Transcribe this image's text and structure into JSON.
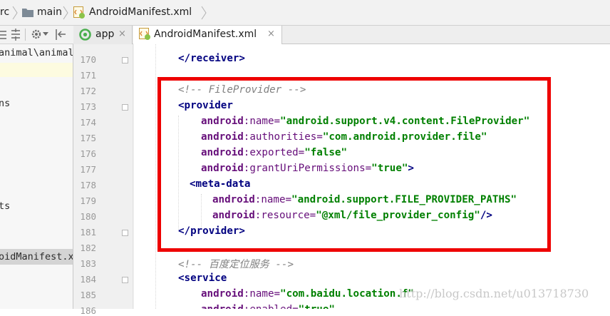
{
  "breadcrumb": {
    "items": [
      {
        "label": "rc",
        "icon": "none"
      },
      {
        "label": "main",
        "icon": "folder-icon"
      },
      {
        "label": "AndroidManifest.xml",
        "icon": "manifest-file-icon"
      }
    ]
  },
  "project_tree": {
    "items": [
      {
        "label": "animal\\animals"
      },
      {
        "label": "ns"
      },
      {
        "label": "ts"
      },
      {
        "label": "oidManifest.x"
      }
    ],
    "selected_item": "oidManifest.x"
  },
  "tabs": [
    {
      "label": "app",
      "icon": "app-module-icon",
      "close": "×",
      "active": false
    },
    {
      "label": "AndroidManifest.xml",
      "icon": "manifest-file-icon",
      "close": "×",
      "active": true
    }
  ],
  "editor": {
    "lines": [
      {
        "num": "170",
        "indent": 2,
        "parts": [
          [
            "tag",
            "</receiver>"
          ]
        ]
      },
      {
        "num": "171",
        "indent": 0,
        "parts": []
      },
      {
        "num": "172",
        "indent": 2,
        "parts": [
          [
            "cmt",
            "<!-- FileProvider -->"
          ]
        ]
      },
      {
        "num": "173",
        "indent": 2,
        "parts": [
          [
            "tag",
            "<provider"
          ]
        ]
      },
      {
        "num": "174",
        "indent": 6,
        "parts": [
          [
            "attrns",
            "android"
          ],
          [
            "attr",
            ":name="
          ],
          [
            "val",
            "\"android.support.v4.content.FileProvider\""
          ]
        ]
      },
      {
        "num": "175",
        "indent": 6,
        "parts": [
          [
            "attrns",
            "android"
          ],
          [
            "attr",
            ":authorities="
          ],
          [
            "val",
            "\"com.android.provider.file\""
          ]
        ]
      },
      {
        "num": "176",
        "indent": 6,
        "parts": [
          [
            "attrns",
            "android"
          ],
          [
            "attr",
            ":exported="
          ],
          [
            "val",
            "\"false\""
          ]
        ]
      },
      {
        "num": "177",
        "indent": 6,
        "parts": [
          [
            "attrns",
            "android"
          ],
          [
            "attr",
            ":grantUriPermissions="
          ],
          [
            "val",
            "\"true\""
          ],
          [
            "tag",
            ">"
          ]
        ]
      },
      {
        "num": "178",
        "indent": 4,
        "parts": [
          [
            "tag",
            "<meta-data"
          ]
        ]
      },
      {
        "num": "179",
        "indent": 8,
        "parts": [
          [
            "attrns",
            "android"
          ],
          [
            "attr",
            ":name="
          ],
          [
            "val",
            "\"android.support.FILE_PROVIDER_PATHS\""
          ]
        ]
      },
      {
        "num": "180",
        "indent": 8,
        "parts": [
          [
            "attrns",
            "android"
          ],
          [
            "attr",
            ":resource="
          ],
          [
            "val",
            "\"@xml/file_provider_config\""
          ],
          [
            "tag",
            "/>"
          ]
        ]
      },
      {
        "num": "181",
        "indent": 2,
        "parts": [
          [
            "tag",
            "</provider>"
          ]
        ]
      },
      {
        "num": "182",
        "indent": 0,
        "parts": []
      },
      {
        "num": "183",
        "indent": 2,
        "parts": [
          [
            "cmt",
            "<!-- 百度定位服务 -->"
          ]
        ]
      },
      {
        "num": "184",
        "indent": 2,
        "parts": [
          [
            "tag",
            "<service"
          ]
        ]
      },
      {
        "num": "185",
        "indent": 6,
        "parts": [
          [
            "attrns",
            "android"
          ],
          [
            "attr",
            ":name="
          ],
          [
            "val",
            "\"com.baidu.location.f\""
          ]
        ]
      },
      {
        "num": "186",
        "indent": 6,
        "parts": [
          [
            "attrns",
            "android"
          ],
          [
            "attr",
            ":enabled="
          ],
          [
            "val",
            "\"true\""
          ]
        ]
      }
    ]
  },
  "watermark": "http://blog.csdn.net/u013718730",
  "colors": {
    "highlight_border": "#ee0000",
    "xml_tag": "#000080",
    "xml_attribute": "#660e7a",
    "xml_value": "#008000",
    "comment": "#808080"
  }
}
